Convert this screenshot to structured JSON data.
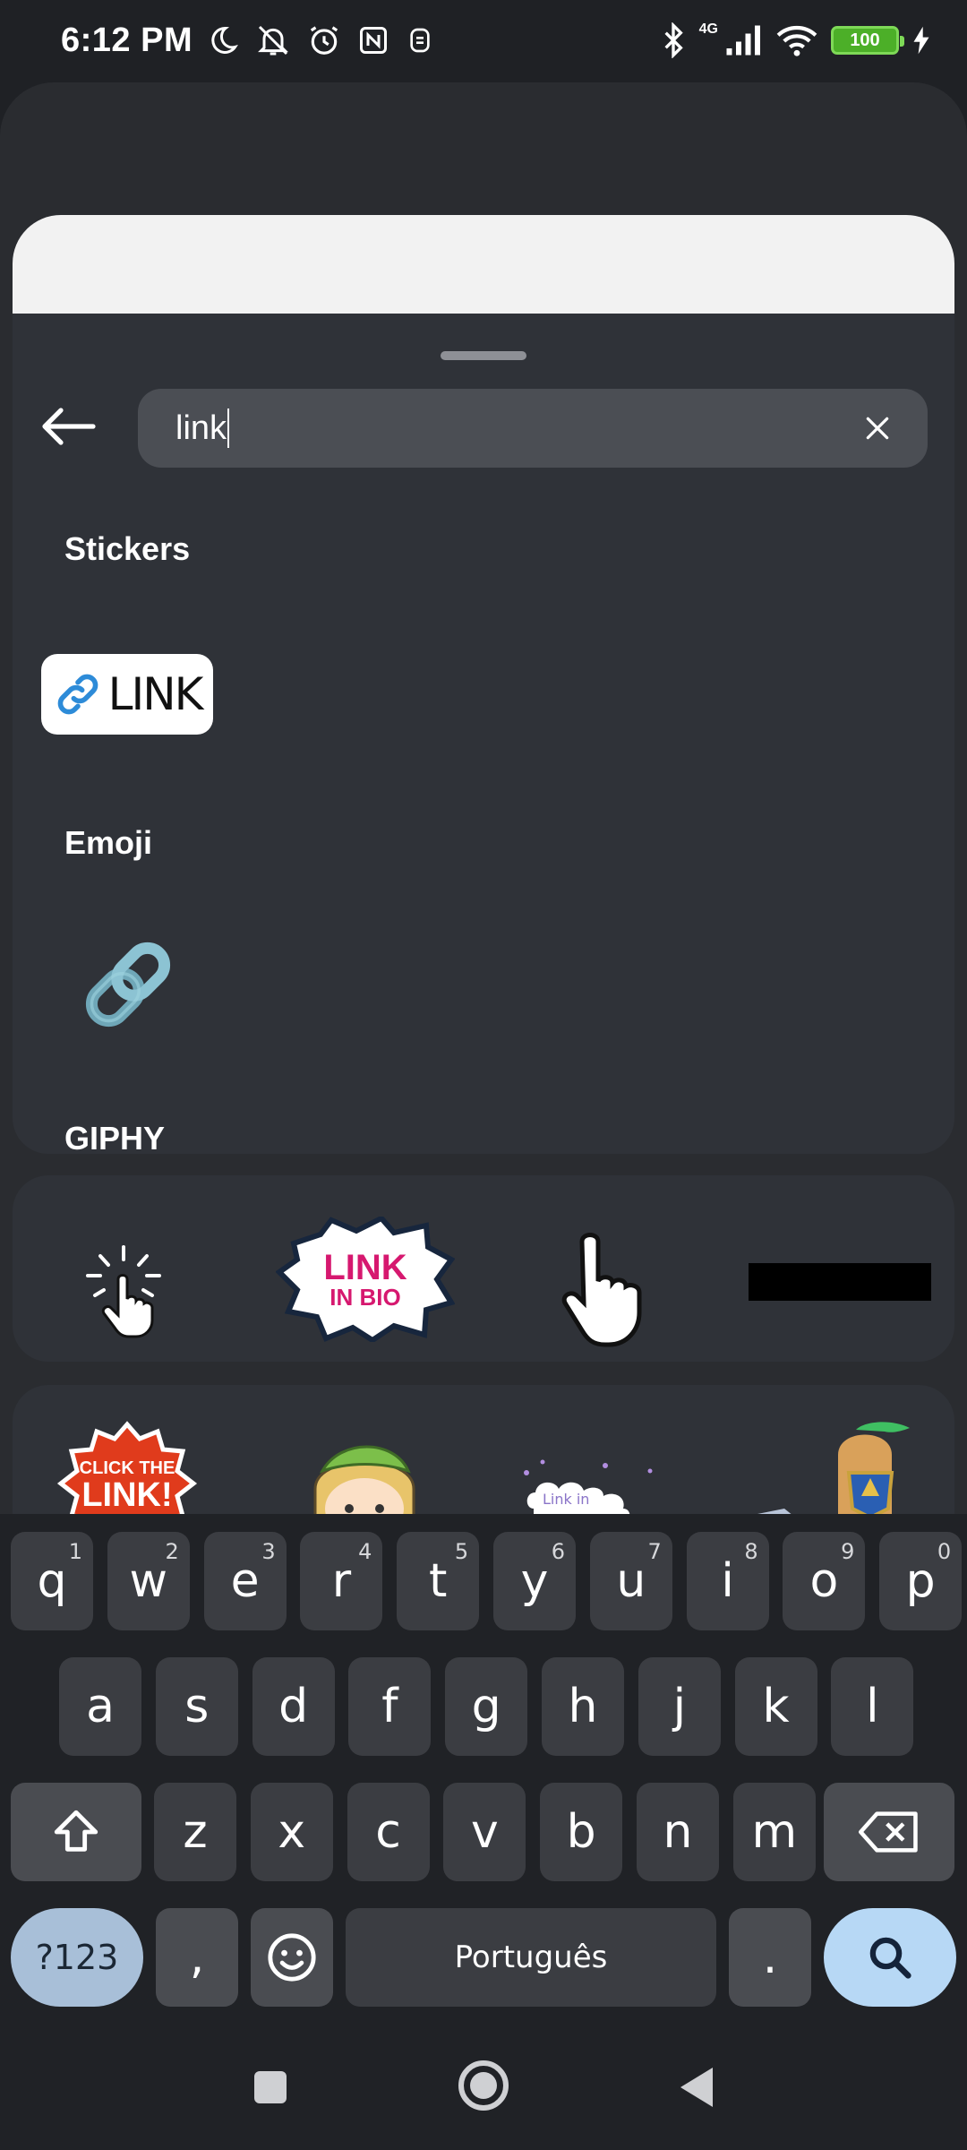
{
  "status_bar": {
    "time": "6:12 PM",
    "network_label": "4G",
    "battery_level": "100",
    "icons": [
      "moon-icon",
      "muted-bell-icon",
      "alarm-icon",
      "nfc-icon",
      "app-icon",
      "bluetooth-icon",
      "signal-icon",
      "wifi-icon",
      "battery-icon",
      "charging-icon"
    ]
  },
  "search": {
    "query": "link"
  },
  "sections": {
    "stickers": "Stickers",
    "emoji": "Emoji",
    "giphy": "GIPHY"
  },
  "stickers": {
    "link_sticker_label": "LINK"
  },
  "gifs": {
    "row1": [
      "click-sparkle-gif",
      "link-in-bio-gif",
      "pointing-hand-gif",
      "black-bar-gif"
    ],
    "link_in_bio_line1": "LINK",
    "link_in_bio_line2": "IN BIO",
    "click_the_link_line1": "CLICK THE",
    "click_the_link_line2": "LINK!",
    "cloud_text": "Link in"
  },
  "keyboard": {
    "row1": [
      {
        "k": "q",
        "h": "1"
      },
      {
        "k": "w",
        "h": "2"
      },
      {
        "k": "e",
        "h": "3"
      },
      {
        "k": "r",
        "h": "4"
      },
      {
        "k": "t",
        "h": "5"
      },
      {
        "k": "y",
        "h": "6"
      },
      {
        "k": "u",
        "h": "7"
      },
      {
        "k": "i",
        "h": "8"
      },
      {
        "k": "o",
        "h": "9"
      },
      {
        "k": "p",
        "h": "0"
      }
    ],
    "row2": [
      "a",
      "s",
      "d",
      "f",
      "g",
      "h",
      "j",
      "k",
      "l"
    ],
    "row3": [
      "z",
      "x",
      "c",
      "v",
      "b",
      "n",
      "m"
    ],
    "symbols_label": "?123",
    "comma": ",",
    "space_label": "Português",
    "period": ".",
    "accent_color": "#b7d8f5"
  },
  "colors": {
    "panel": "#2f3238",
    "background": "#1f2125",
    "key": "#3b3d42"
  }
}
